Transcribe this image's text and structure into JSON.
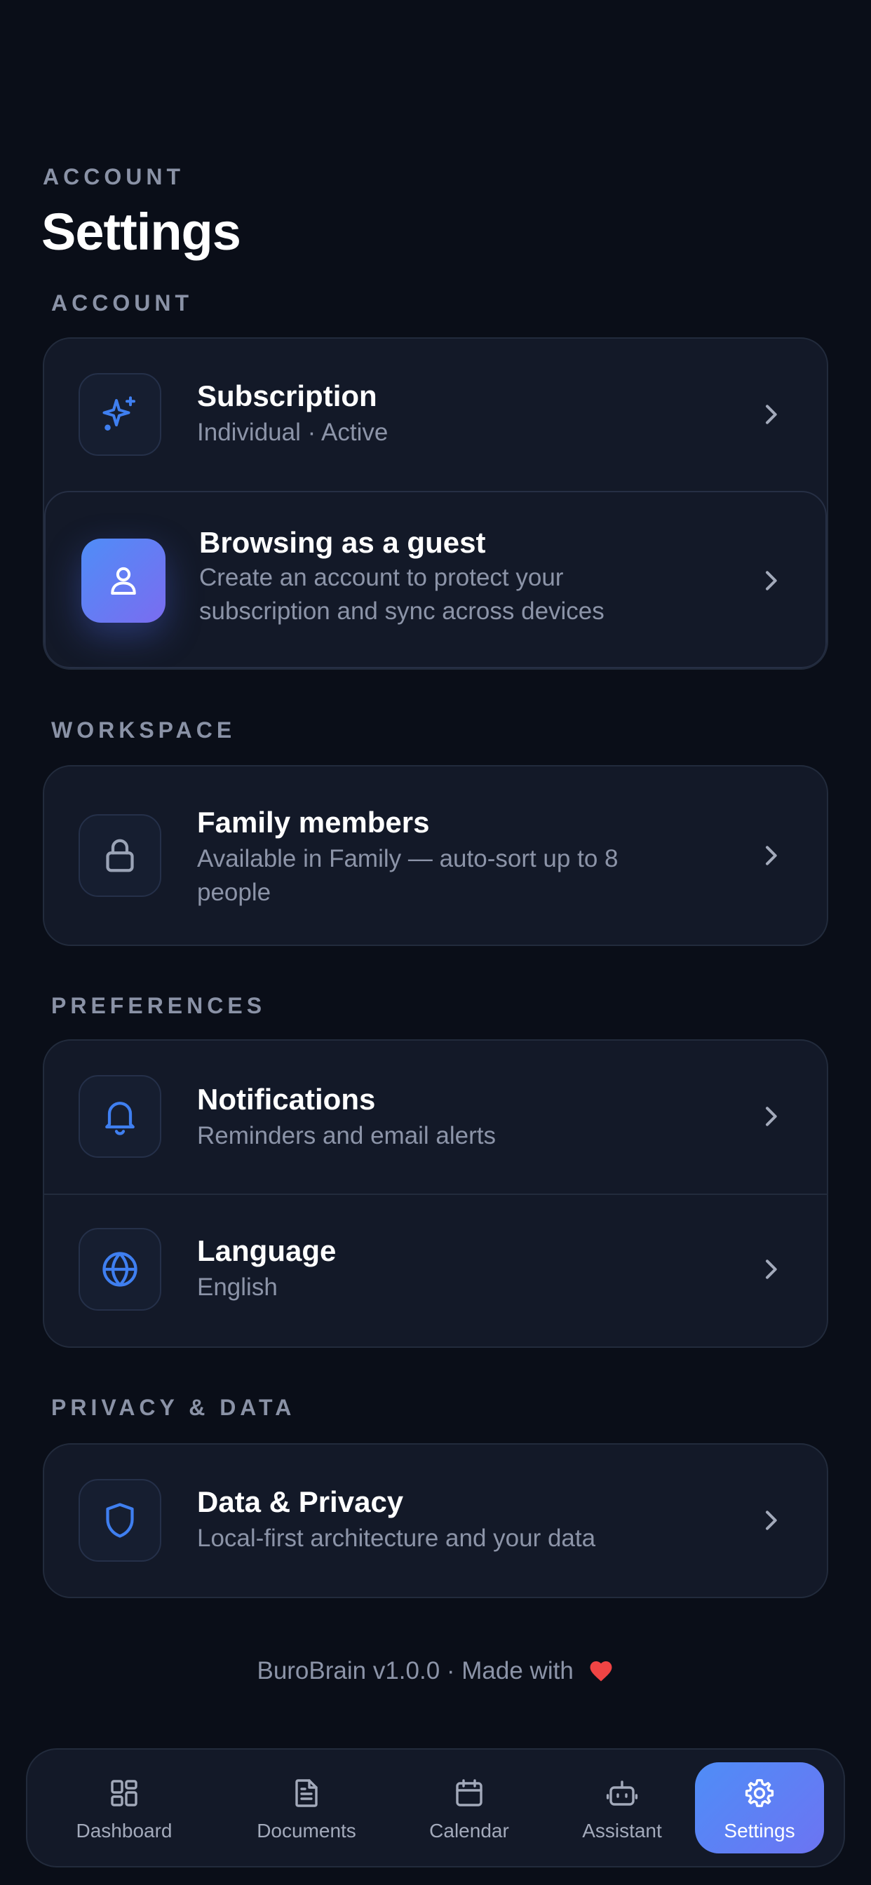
{
  "header": {
    "eyebrow": "ACCOUNT",
    "title": "Settings"
  },
  "sections": {
    "account": {
      "label": "ACCOUNT",
      "subscription": {
        "title": "Subscription",
        "subtitle": "Individual · Active",
        "icon": "sparkle-icon"
      },
      "guest": {
        "title": "Browsing as a guest",
        "subtitle": "Create an account to protect your subscription and sync across devices",
        "icon": "user-icon"
      }
    },
    "workspace": {
      "label": "WORKSPACE",
      "family": {
        "title": "Family members",
        "subtitle": "Available in Family — auto-sort up to 8 people",
        "icon": "lock-icon"
      }
    },
    "preferences": {
      "label": "PREFERENCES",
      "notifications": {
        "title": "Notifications",
        "subtitle": "Reminders and email alerts",
        "icon": "bell-icon"
      },
      "language": {
        "title": "Language",
        "subtitle": "English",
        "icon": "globe-icon"
      }
    },
    "privacy": {
      "label": "PRIVACY & DATA",
      "data_privacy": {
        "title": "Data & Privacy",
        "subtitle": "Local-first architecture and your data",
        "icon": "shield-icon"
      }
    }
  },
  "footer": {
    "text": "BuroBrain v1.0.0 · Made with"
  },
  "tabbar": {
    "items": [
      {
        "label": "Dashboard",
        "icon": "dashboard-icon",
        "active": false
      },
      {
        "label": "Documents",
        "icon": "document-icon",
        "active": false
      },
      {
        "label": "Calendar",
        "icon": "calendar-icon",
        "active": false
      },
      {
        "label": "Assistant",
        "icon": "robot-icon",
        "active": false
      },
      {
        "label": "Settings",
        "icon": "gear-icon",
        "active": true
      }
    ]
  },
  "colors": {
    "background": "#0a0e18",
    "card": "#131928",
    "accent": "#4f8df7",
    "accent_gradient_end": "#7a6cf0",
    "heart": "#ef4444",
    "muted_text": "#8c94a8"
  }
}
